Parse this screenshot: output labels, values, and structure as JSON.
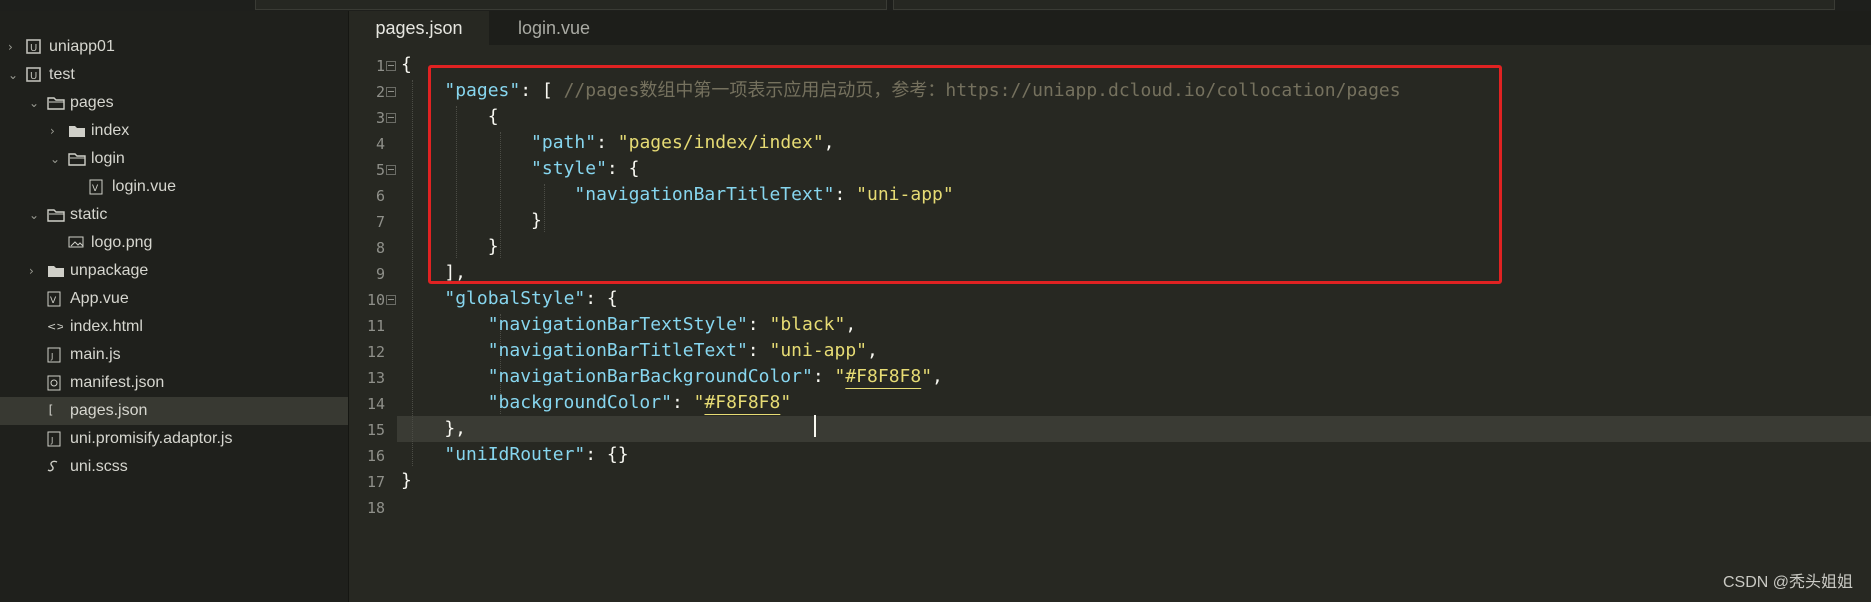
{
  "sidebar": {
    "items": [
      {
        "label": "uniapp01",
        "chevron": "›",
        "icon": "project-icon"
      },
      {
        "label": "test",
        "chevron": "⌄",
        "icon": "project-icon"
      },
      {
        "label": "pages",
        "chevron": "⌄",
        "icon": "folder-open-icon"
      },
      {
        "label": "index",
        "chevron": "›",
        "icon": "folder-icon"
      },
      {
        "label": "login",
        "chevron": "⌄",
        "icon": "folder-open-icon"
      },
      {
        "label": "login.vue",
        "chevron": "",
        "icon": "vue-file-icon"
      },
      {
        "label": "static",
        "chevron": "⌄",
        "icon": "folder-open-icon"
      },
      {
        "label": "logo.png",
        "chevron": "",
        "icon": "image-file-icon"
      },
      {
        "label": "unpackage",
        "chevron": "›",
        "icon": "folder-icon"
      },
      {
        "label": "App.vue",
        "chevron": "",
        "icon": "vue-file-icon"
      },
      {
        "label": "index.html",
        "chevron": "",
        "icon": "html-file-icon"
      },
      {
        "label": "main.js",
        "chevron": "",
        "icon": "js-file-icon"
      },
      {
        "label": "manifest.json",
        "chevron": "",
        "icon": "manifest-file-icon"
      },
      {
        "label": "pages.json",
        "chevron": "",
        "icon": "json-file-icon",
        "selected": true
      },
      {
        "label": "uni.promisify.adaptor.js",
        "chevron": "",
        "icon": "js-file-icon"
      },
      {
        "label": "uni.scss",
        "chevron": "",
        "icon": "scss-file-icon"
      }
    ]
  },
  "tabs": [
    {
      "label": "pages.json",
      "active": true
    },
    {
      "label": "login.vue",
      "active": false
    }
  ],
  "editor": {
    "line_numbers": [
      "1",
      "2",
      "3",
      "4",
      "5",
      "6",
      "7",
      "8",
      "9",
      "10",
      "11",
      "12",
      "13",
      "14",
      "15",
      "16",
      "17",
      "18"
    ],
    "lines": [
      {
        "t": [
          [
            "p",
            "{"
          ]
        ]
      },
      {
        "t": [
          [
            "p",
            "    "
          ],
          [
            "k",
            "\"pages\""
          ],
          [
            "p",
            ": [ "
          ],
          [
            "c",
            "//pages数组中第一项表示应用启动页，参考：https://uniapp.dcloud.io/collocation/pages"
          ]
        ]
      },
      {
        "t": [
          [
            "p",
            "        {"
          ]
        ]
      },
      {
        "t": [
          [
            "p",
            "            "
          ],
          [
            "k",
            "\"path\""
          ],
          [
            "p",
            ": "
          ],
          [
            "s",
            "\"pages/index/index\""
          ],
          [
            "p",
            ","
          ]
        ]
      },
      {
        "t": [
          [
            "p",
            "            "
          ],
          [
            "k",
            "\"style\""
          ],
          [
            "p",
            ": {"
          ]
        ]
      },
      {
        "t": [
          [
            "p",
            "                "
          ],
          [
            "k",
            "\"navigationBarTitleText\""
          ],
          [
            "p",
            ": "
          ],
          [
            "s",
            "\"uni-app\""
          ]
        ]
      },
      {
        "t": [
          [
            "p",
            "            }"
          ]
        ]
      },
      {
        "t": [
          [
            "p",
            "        }"
          ]
        ]
      },
      {
        "t": [
          [
            "p",
            "    ],"
          ]
        ]
      },
      {
        "t": [
          [
            "p",
            "    "
          ],
          [
            "k",
            "\"globalStyle\""
          ],
          [
            "p",
            ": {"
          ]
        ]
      },
      {
        "t": [
          [
            "p",
            "        "
          ],
          [
            "k",
            "\"navigationBarTextStyle\""
          ],
          [
            "p",
            ": "
          ],
          [
            "s",
            "\"black\""
          ],
          [
            "p",
            ","
          ]
        ]
      },
      {
        "t": [
          [
            "p",
            "        "
          ],
          [
            "k",
            "\"navigationBarTitleText\""
          ],
          [
            "p",
            ": "
          ],
          [
            "s",
            "\"uni-app\""
          ],
          [
            "p",
            ","
          ]
        ]
      },
      {
        "t": [
          [
            "p",
            "        "
          ],
          [
            "k",
            "\"navigationBarBackgroundColor\""
          ],
          [
            "p",
            ": "
          ],
          [
            "s",
            "\""
          ],
          [
            "su",
            "#F8F8F8"
          ],
          [
            "s",
            "\""
          ],
          [
            "p",
            ","
          ]
        ]
      },
      {
        "t": [
          [
            "p",
            "        "
          ],
          [
            "k",
            "\"backgroundColor\""
          ],
          [
            "p",
            ": "
          ],
          [
            "s",
            "\""
          ],
          [
            "su",
            "#F8F8F8"
          ],
          [
            "s",
            "\""
          ]
        ]
      },
      {
        "t": [
          [
            "p",
            "    },"
          ]
        ]
      },
      {
        "t": [
          [
            "p",
            "    "
          ],
          [
            "k",
            "\"uniIdRouter\""
          ],
          [
            "p",
            ": {}"
          ]
        ]
      },
      {
        "t": [
          [
            "p",
            "}"
          ]
        ]
      },
      {
        "t": [
          [
            "p",
            ""
          ]
        ]
      }
    ],
    "folds": [
      1,
      2,
      3,
      5,
      10
    ]
  },
  "watermark": "CSDN @秃头姐姐",
  "colors": {
    "highlight_box": "#e02222",
    "keyword": "#87d6ef",
    "string": "#e6db74",
    "comment": "#75715e"
  }
}
